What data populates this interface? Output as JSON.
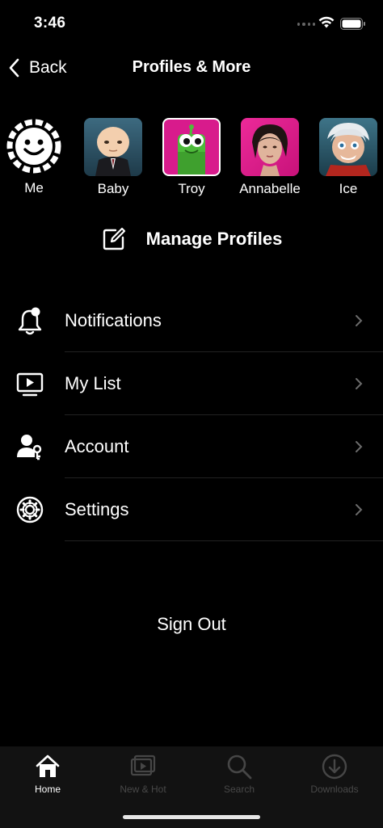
{
  "status_bar": {
    "time": "3:46"
  },
  "nav": {
    "back_label": "Back",
    "title": "Profiles & More"
  },
  "profiles": [
    {
      "name": "Me",
      "icon": "smiley-avatar-icon"
    },
    {
      "name": "Baby",
      "bg": "#2b4a5c"
    },
    {
      "name": "Troy",
      "bg": "#d81b8c"
    },
    {
      "name": "Annabelle",
      "bg": "#e0198a"
    },
    {
      "name": "Ice",
      "bg": "#2a5a6e"
    }
  ],
  "manage_profiles": {
    "label": "Manage Profiles",
    "icon": "edit-icon"
  },
  "menu": [
    {
      "label": "Notifications",
      "icon": "bell-icon"
    },
    {
      "label": "My List",
      "icon": "play-screen-icon"
    },
    {
      "label": "Account",
      "icon": "account-key-icon"
    },
    {
      "label": "Settings",
      "icon": "gear-icon"
    }
  ],
  "sign_out": "Sign Out",
  "tab_bar": {
    "tabs": [
      {
        "label": "Home",
        "icon": "home-icon",
        "active": true
      },
      {
        "label": "New & Hot",
        "icon": "new-hot-icon",
        "active": false
      },
      {
        "label": "Search",
        "icon": "search-icon",
        "active": false
      },
      {
        "label": "Downloads",
        "icon": "download-icon",
        "active": false
      }
    ]
  }
}
